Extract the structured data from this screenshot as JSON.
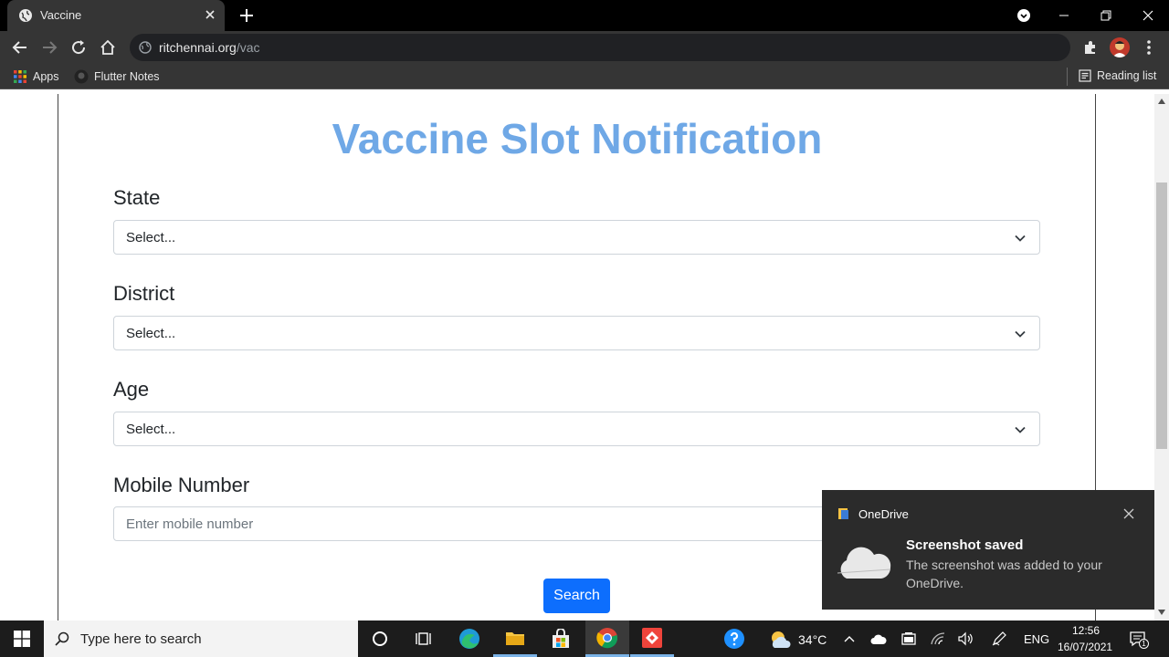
{
  "browser": {
    "tab_title": "Vaccine",
    "url_host": "ritchennai.org",
    "url_path": "/vac",
    "bookmarks": [
      {
        "label": "Apps",
        "icon": "apps-grid-icon"
      },
      {
        "label": "Flutter Notes",
        "icon": "github-icon"
      }
    ],
    "reading_list": "Reading list"
  },
  "page": {
    "heading": "Vaccine Slot Notification",
    "heading_color": "#6fa8e6",
    "fields": [
      {
        "label": "State",
        "value": "Select..."
      },
      {
        "label": "District",
        "value": "Select..."
      },
      {
        "label": "Age",
        "value": "Select..."
      }
    ],
    "mobile": {
      "label": "Mobile Number",
      "placeholder": "Enter mobile number"
    },
    "search_button": "Search",
    "button_color": "#0d6efd"
  },
  "toast": {
    "app": "OneDrive",
    "title": "Screenshot saved",
    "message": "The screenshot was added to your OneDrive."
  },
  "taskbar": {
    "search_placeholder": "Type here to search",
    "weather": "34°C",
    "language": "ENG",
    "time": "12:56",
    "date": "16/07/2021",
    "notification_count": "1"
  }
}
